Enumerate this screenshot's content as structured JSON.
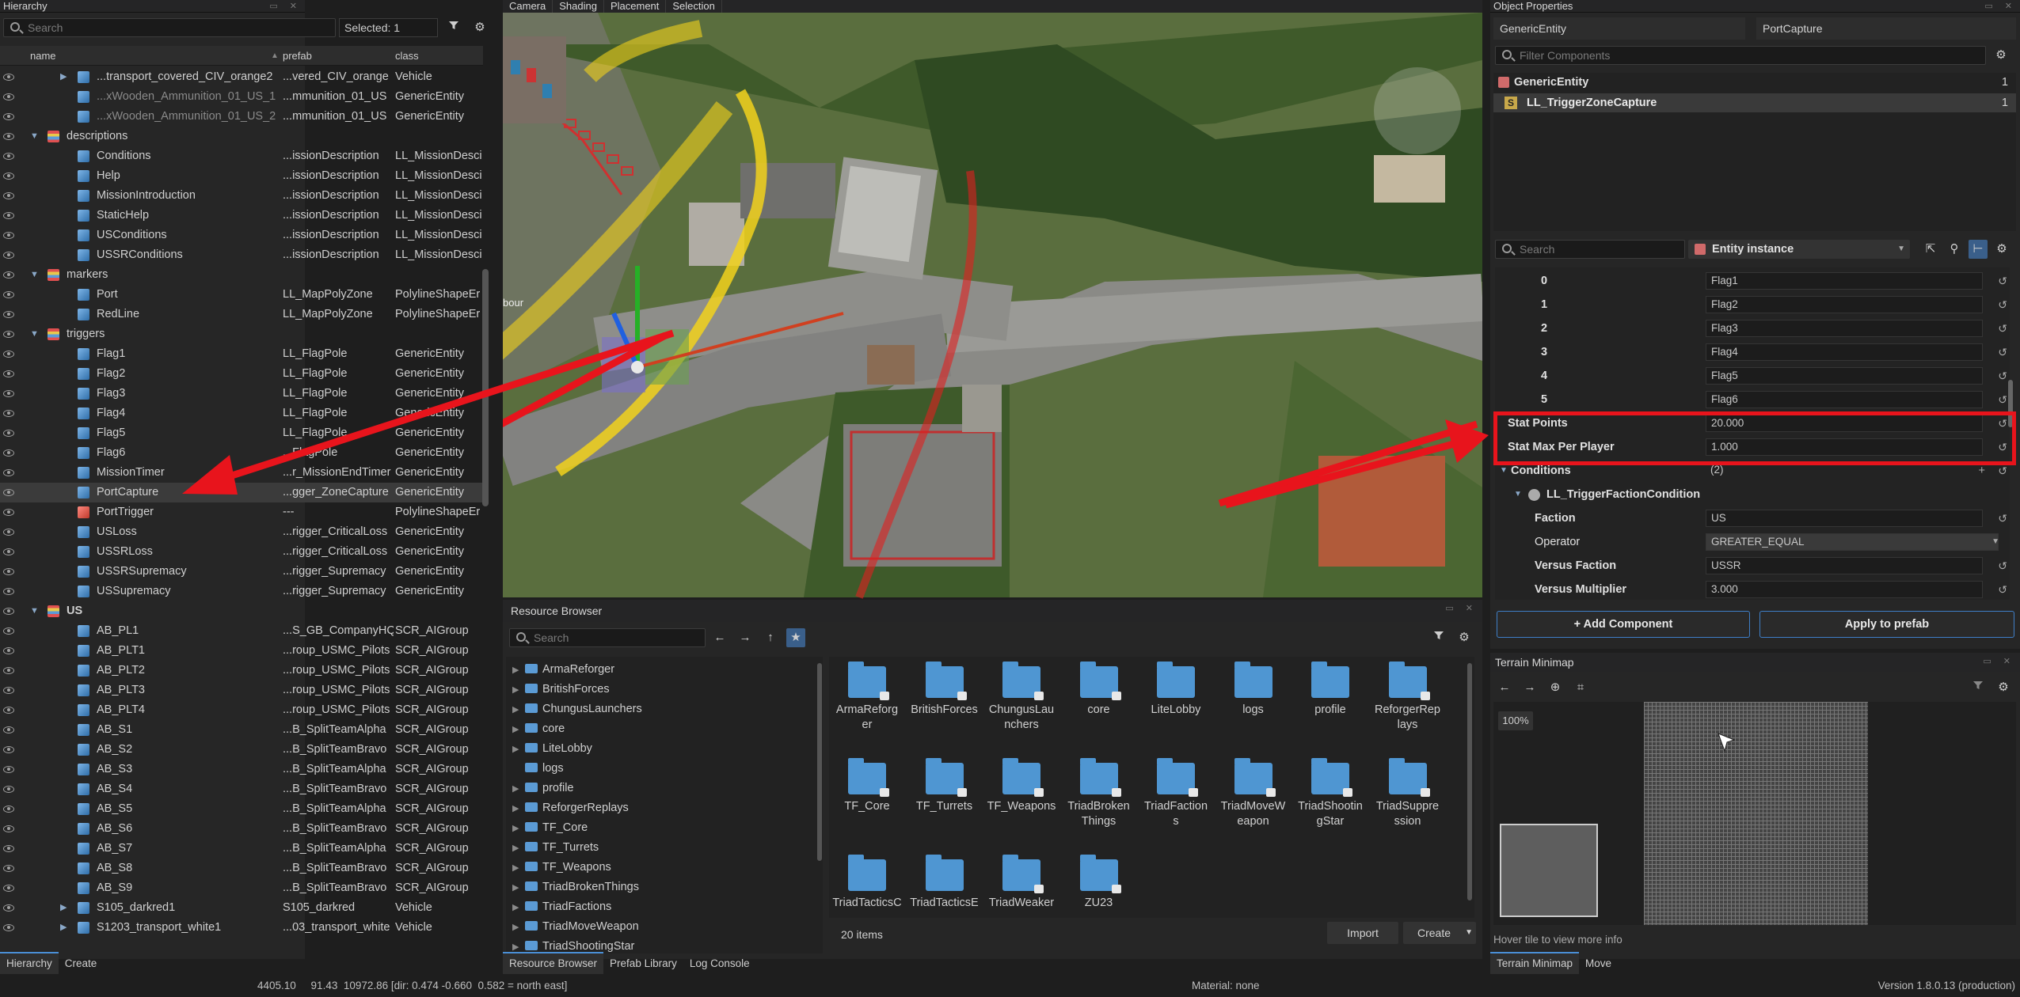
{
  "hierarchy": {
    "title": "Hierarchy",
    "search_placeholder": "Search",
    "selected_label": "Selected: 1",
    "columns": {
      "name": "name",
      "prefab": "prefab",
      "class": "class"
    },
    "rows": [
      {
        "indent": 1,
        "arrow": "▶",
        "icon": "ent",
        "name": "...transport_covered_CIV_orange2",
        "prefab": "...vered_CIV_orange",
        "class": "Vehicle",
        "dim": false
      },
      {
        "indent": 1,
        "arrow": "",
        "icon": "ent",
        "name": "...xWooden_Ammunition_01_US_1",
        "prefab": "...mmunition_01_US",
        "class": "GenericEntity",
        "dim": true
      },
      {
        "indent": 1,
        "arrow": "",
        "icon": "ent",
        "name": "...xWooden_Ammunition_01_US_2",
        "prefab": "...mmunition_01_US",
        "class": "GenericEntity",
        "dim": true
      },
      {
        "indent": 0,
        "arrow": "▼",
        "icon": "fold",
        "name": "descriptions",
        "prefab": "",
        "class": "",
        "dim": false
      },
      {
        "indent": 1,
        "arrow": "",
        "icon": "ent",
        "name": "Conditions",
        "prefab": "...issionDescription",
        "class": "LL_MissionDesci",
        "dim": false
      },
      {
        "indent": 1,
        "arrow": "",
        "icon": "ent",
        "name": "Help",
        "prefab": "...issionDescription",
        "class": "LL_MissionDesci",
        "dim": false
      },
      {
        "indent": 1,
        "arrow": "",
        "icon": "ent",
        "name": "MissionIntroduction",
        "prefab": "...issionDescription",
        "class": "LL_MissionDesci",
        "dim": false
      },
      {
        "indent": 1,
        "arrow": "",
        "icon": "ent",
        "name": "StaticHelp",
        "prefab": "...issionDescription",
        "class": "LL_MissionDesci",
        "dim": false
      },
      {
        "indent": 1,
        "arrow": "",
        "icon": "ent",
        "name": "USConditions",
        "prefab": "...issionDescription",
        "class": "LL_MissionDesci",
        "dim": false
      },
      {
        "indent": 1,
        "arrow": "",
        "icon": "ent",
        "name": "USSRConditions",
        "prefab": "...issionDescription",
        "class": "LL_MissionDesci",
        "dim": false
      },
      {
        "indent": 0,
        "arrow": "▼",
        "icon": "fold",
        "name": "markers",
        "prefab": "",
        "class": "",
        "dim": false
      },
      {
        "indent": 1,
        "arrow": "",
        "icon": "ent",
        "name": "Port",
        "prefab": "LL_MapPolyZone",
        "class": "PolylineShapeEr",
        "dim": false
      },
      {
        "indent": 1,
        "arrow": "",
        "icon": "ent",
        "name": "RedLine",
        "prefab": "LL_MapPolyZone",
        "class": "PolylineShapeEr",
        "dim": false
      },
      {
        "indent": 0,
        "arrow": "▼",
        "icon": "fold",
        "name": "triggers",
        "prefab": "",
        "class": "",
        "dim": false
      },
      {
        "indent": 1,
        "arrow": "",
        "icon": "ent",
        "name": "Flag1",
        "prefab": "LL_FlagPole",
        "class": "GenericEntity",
        "dim": false
      },
      {
        "indent": 1,
        "arrow": "",
        "icon": "ent",
        "name": "Flag2",
        "prefab": "LL_FlagPole",
        "class": "GenericEntity",
        "dim": false
      },
      {
        "indent": 1,
        "arrow": "",
        "icon": "ent",
        "name": "Flag3",
        "prefab": "LL_FlagPole",
        "class": "GenericEntity",
        "dim": false
      },
      {
        "indent": 1,
        "arrow": "",
        "icon": "ent",
        "name": "Flag4",
        "prefab": "LL_FlagPole",
        "class": "GenericEntity",
        "dim": false
      },
      {
        "indent": 1,
        "arrow": "",
        "icon": "ent",
        "name": "Flag5",
        "prefab": "LL_FlagPole",
        "class": "GenericEntity",
        "dim": false
      },
      {
        "indent": 1,
        "arrow": "",
        "icon": "ent",
        "name": "Flag6",
        "prefab": "...FlagPole",
        "class": "GenericEntity",
        "dim": false
      },
      {
        "indent": 1,
        "arrow": "",
        "icon": "ent",
        "name": "MissionTimer",
        "prefab": "...r_MissionEndTimer",
        "class": "GenericEntity",
        "dim": false
      },
      {
        "indent": 1,
        "arrow": "",
        "icon": "ent",
        "name": "PortCapture",
        "prefab": "...gger_ZoneCapture",
        "class": "GenericEntity",
        "dim": false,
        "selected": true
      },
      {
        "indent": 1,
        "arrow": "",
        "icon": "pol",
        "name": "PortTrigger",
        "prefab": "---",
        "class": "PolylineShapeEr",
        "dim": false
      },
      {
        "indent": 1,
        "arrow": "",
        "icon": "ent",
        "name": "USLoss",
        "prefab": "...rigger_CriticalLoss",
        "class": "GenericEntity",
        "dim": false
      },
      {
        "indent": 1,
        "arrow": "",
        "icon": "ent",
        "name": "USSRLoss",
        "prefab": "...rigger_CriticalLoss",
        "class": "GenericEntity",
        "dim": false
      },
      {
        "indent": 1,
        "arrow": "",
        "icon": "ent",
        "name": "USSRSupremacy",
        "prefab": "...rigger_Supremacy",
        "class": "GenericEntity",
        "dim": false
      },
      {
        "indent": 1,
        "arrow": "",
        "icon": "ent",
        "name": "USSupremacy",
        "prefab": "...rigger_Supremacy",
        "class": "GenericEntity",
        "dim": false
      },
      {
        "indent": 0,
        "arrow": "▼",
        "icon": "fold",
        "name": "US",
        "prefab": "",
        "class": "",
        "dim": false,
        "bold": true
      },
      {
        "indent": 1,
        "arrow": "",
        "icon": "ent",
        "name": "AB_PL1",
        "prefab": "...S_GB_CompanyHQ",
        "class": "SCR_AIGroup",
        "dim": false
      },
      {
        "indent": 1,
        "arrow": "",
        "icon": "ent",
        "name": "AB_PLT1",
        "prefab": "...roup_USMC_Pilots",
        "class": "SCR_AIGroup",
        "dim": false
      },
      {
        "indent": 1,
        "arrow": "",
        "icon": "ent",
        "name": "AB_PLT2",
        "prefab": "...roup_USMC_Pilots",
        "class": "SCR_AIGroup",
        "dim": false
      },
      {
        "indent": 1,
        "arrow": "",
        "icon": "ent",
        "name": "AB_PLT3",
        "prefab": "...roup_USMC_Pilots",
        "class": "SCR_AIGroup",
        "dim": false
      },
      {
        "indent": 1,
        "arrow": "",
        "icon": "ent",
        "name": "AB_PLT4",
        "prefab": "...roup_USMC_Pilots",
        "class": "SCR_AIGroup",
        "dim": false
      },
      {
        "indent": 1,
        "arrow": "",
        "icon": "ent",
        "name": "AB_S1",
        "prefab": "...B_SplitTeamAlpha",
        "class": "SCR_AIGroup",
        "dim": false
      },
      {
        "indent": 1,
        "arrow": "",
        "icon": "ent",
        "name": "AB_S2",
        "prefab": "...B_SplitTeamBravo",
        "class": "SCR_AIGroup",
        "dim": false
      },
      {
        "indent": 1,
        "arrow": "",
        "icon": "ent",
        "name": "AB_S3",
        "prefab": "...B_SplitTeamAlpha",
        "class": "SCR_AIGroup",
        "dim": false
      },
      {
        "indent": 1,
        "arrow": "",
        "icon": "ent",
        "name": "AB_S4",
        "prefab": "...B_SplitTeamBravo",
        "class": "SCR_AIGroup",
        "dim": false
      },
      {
        "indent": 1,
        "arrow": "",
        "icon": "ent",
        "name": "AB_S5",
        "prefab": "...B_SplitTeamAlpha",
        "class": "SCR_AIGroup",
        "dim": false
      },
      {
        "indent": 1,
        "arrow": "",
        "icon": "ent",
        "name": "AB_S6",
        "prefab": "...B_SplitTeamBravo",
        "class": "SCR_AIGroup",
        "dim": false
      },
      {
        "indent": 1,
        "arrow": "",
        "icon": "ent",
        "name": "AB_S7",
        "prefab": "...B_SplitTeamAlpha",
        "class": "SCR_AIGroup",
        "dim": false
      },
      {
        "indent": 1,
        "arrow": "",
        "icon": "ent",
        "name": "AB_S8",
        "prefab": "...B_SplitTeamBravo",
        "class": "SCR_AIGroup",
        "dim": false
      },
      {
        "indent": 1,
        "arrow": "",
        "icon": "ent",
        "name": "AB_S9",
        "prefab": "...B_SplitTeamBravo",
        "class": "SCR_AIGroup",
        "dim": false
      },
      {
        "indent": 1,
        "arrow": "▶",
        "icon": "ent",
        "name": "S105_darkred1",
        "prefab": "S105_darkred",
        "class": "Vehicle",
        "dim": false
      },
      {
        "indent": 1,
        "arrow": "▶",
        "icon": "ent",
        "name": "S1203_transport_white1",
        "prefab": "...03_transport_white",
        "class": "Vehicle",
        "dim": false
      }
    ],
    "bottom_tabs": [
      "Hierarchy",
      "Create"
    ]
  },
  "viewport": {
    "tabs": [
      "Camera",
      "Shading",
      "Placement",
      "Selection"
    ],
    "overlay_text": "bour"
  },
  "resource_browser": {
    "title": "Resource Browser",
    "search_placeholder": "Search",
    "tree": [
      {
        "name": "ArmaReforger",
        "arrow": true
      },
      {
        "name": "BritishForces",
        "arrow": true
      },
      {
        "name": "ChungusLaunchers",
        "arrow": true
      },
      {
        "name": "core",
        "arrow": true
      },
      {
        "name": "LiteLobby",
        "arrow": true
      },
      {
        "name": "logs",
        "arrow": false
      },
      {
        "name": "profile",
        "arrow": true
      },
      {
        "name": "ReforgerReplays",
        "arrow": true
      },
      {
        "name": "TF_Core",
        "arrow": true
      },
      {
        "name": "TF_Turrets",
        "arrow": true
      },
      {
        "name": "TF_Weapons",
        "arrow": true
      },
      {
        "name": "TriadBrokenThings",
        "arrow": true
      },
      {
        "name": "TriadFactions",
        "arrow": true
      },
      {
        "name": "TriadMoveWeapon",
        "arrow": true
      },
      {
        "name": "TriadShootingStar",
        "arrow": true
      }
    ],
    "items": [
      {
        "label": "ArmaReforg\ner",
        "lock": true
      },
      {
        "label": "BritishForces",
        "lock": true
      },
      {
        "label": "ChungusLau\nnchers",
        "lock": true
      },
      {
        "label": "core",
        "lock": true
      },
      {
        "label": "LiteLobby",
        "lock": false
      },
      {
        "label": "logs",
        "lock": false
      },
      {
        "label": "profile",
        "lock": false
      },
      {
        "label": "ReforgerRep\nlays",
        "lock": true
      },
      {
        "label": "TF_Core",
        "lock": true
      },
      {
        "label": "TF_Turrets",
        "lock": true
      },
      {
        "label": "TF_Weapons",
        "lock": true
      },
      {
        "label": "TriadBroken\nThings",
        "lock": true
      },
      {
        "label": "TriadFaction\ns",
        "lock": true
      },
      {
        "label": "TriadMoveW\neapon",
        "lock": true
      },
      {
        "label": "TriadShootin\ngStar",
        "lock": true
      },
      {
        "label": "TriadSuppre\nssion",
        "lock": true
      },
      {
        "label": "TriadTacticsC",
        "lock": false
      },
      {
        "label": "TriadTacticsE",
        "lock": false
      },
      {
        "label": "TriadWeaker",
        "lock": true
      },
      {
        "label": "ZU23",
        "lock": true
      }
    ],
    "count": "20 items",
    "import_label": "Import",
    "create_label": "Create",
    "bottom_tabs": [
      "Resource Browser",
      "Prefab Library",
      "Log Console"
    ]
  },
  "object_properties": {
    "title": "Object Properties",
    "entity_class": "GenericEntity",
    "entity_name": "PortCapture",
    "filter_placeholder": "Filter Components",
    "components": [
      {
        "name": "GenericEntity",
        "count": "1"
      },
      {
        "name": "LL_TriggerZoneCapture",
        "count": "1"
      }
    ],
    "search_placeholder": "Search",
    "instance_select": "Entity instance",
    "props": [
      {
        "label": "0",
        "value": "Flag1",
        "kind": "idx"
      },
      {
        "label": "1",
        "value": "Flag2",
        "kind": "idx"
      },
      {
        "label": "2",
        "value": "Flag3",
        "kind": "idx"
      },
      {
        "label": "3",
        "value": "Flag4",
        "kind": "idx"
      },
      {
        "label": "4",
        "value": "Flag5",
        "kind": "idx"
      },
      {
        "label": "5",
        "value": "Flag6",
        "kind": "idx"
      },
      {
        "label": "Stat Points",
        "value": "20.000",
        "kind": "val"
      },
      {
        "label": "Stat Max Per Player",
        "value": "1.000",
        "kind": "val"
      },
      {
        "label": "Conditions",
        "value": "(2)",
        "kind": "group"
      },
      {
        "label": "LL_TriggerFactionCondition",
        "value": "",
        "kind": "sub"
      },
      {
        "label": "Faction",
        "value": "US",
        "kind": "val2"
      },
      {
        "label": "Operator",
        "value": "GREATER_EQUAL",
        "kind": "sel"
      },
      {
        "label": "Versus Faction",
        "value": "USSR",
        "kind": "val2"
      },
      {
        "label": "Versus Multiplier",
        "value": "3.000",
        "kind": "val2"
      }
    ],
    "add_component": "+ Add Component",
    "apply_prefab": "Apply to prefab"
  },
  "terrain_minimap": {
    "title": "Terrain Minimap",
    "zoom": "100%",
    "hint": "Hover tile to view more info",
    "bottom_tabs": [
      "Terrain Minimap",
      "Move"
    ]
  },
  "status": {
    "coords": "4405.10     91.43  10972.86 [dir: 0.474 -0.660  0.582 = north east]",
    "material": "Material: none",
    "version": "Version 1.8.0.13 (production)"
  }
}
